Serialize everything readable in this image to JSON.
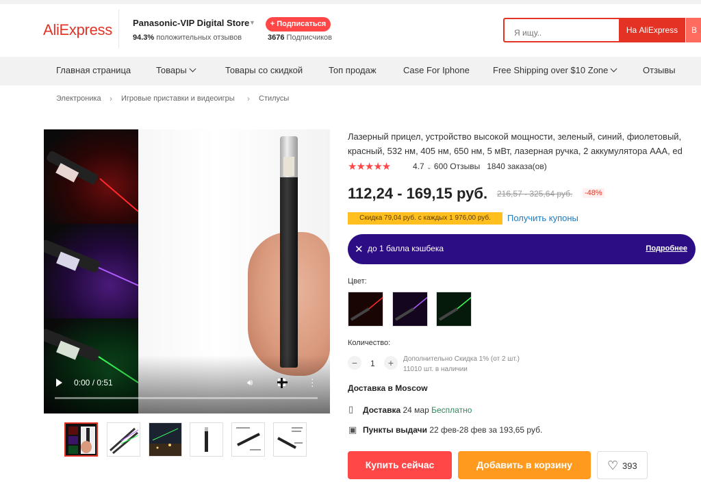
{
  "header": {
    "logo": "AliExpress",
    "store_name": "Panasonic-VIP Digital Store",
    "feedback_percent": "94.3%",
    "feedback_label": "положительных отзывов",
    "subscribe_label": "+ Подписаться",
    "subscribers_count": "3676",
    "subscribers_label": "Подписчиков",
    "search_placeholder": "Я ищу..",
    "search_on_aliexpress": "На AliExpress",
    "search_in_store": "В"
  },
  "nav": {
    "items": [
      "Главная страница",
      "Товары",
      "Товары со скидкой",
      "Топ продаж",
      "Case For Iphone",
      "Free Shipping over $10 Zone",
      "Отзывы"
    ]
  },
  "breadcrumb": [
    "Электроника",
    "Игровые приставки и видеоигры",
    "Стилусы"
  ],
  "video": {
    "time": "0:00 / 0:51"
  },
  "product": {
    "title": "Лазерный прицел, устройство высокой мощности, зеленый, синий, фиолетовый, красный, 532 нм, 405 нм, 650 нм, 5 мВт, лазерная ручка, 2 аккумулятора AAA, ed",
    "stars": "★★★★★",
    "rating": "4.7",
    "reviews": "600 Отзывы",
    "orders": "1840 заказа(ов)",
    "price": "112,24 - 169,15 руб.",
    "old_price": "216,57 - 325,64 руб.",
    "discount": "-48%",
    "coupon_text": "Скидка 79,04 руб. с каждых 1 976,00 руб.",
    "coupon_link": "Получить купоны",
    "cashback_text": "до 1 балла кэшбека",
    "cashback_more": "Подробнее",
    "color_label": "Цвет:",
    "color_options": [
      "red",
      "violet",
      "green"
    ],
    "quantity_label": "Количество:",
    "quantity": "1",
    "quantity_note": "Дополнительно Скидка 1% (от 2 шт.)",
    "stock": "11010 шт. в наличии",
    "shipping_title": "Доставка в Moscow",
    "delivery_label": "Доставка",
    "delivery_date": "24 мар",
    "delivery_price": "Бесплатно",
    "pickup_label": "Пункты выдачи",
    "pickup_info": "22 фев-28 фев за 193,65 руб.",
    "buy_now": "Купить сейчас",
    "add_to_cart": "Добавить в корзину",
    "wishlist_count": "393"
  },
  "colors": {
    "brand": "#e43225",
    "buy": "#ff4747",
    "cart": "#ff9a1f",
    "cashback": "#2c0d84",
    "coupon": "#ffc01f"
  }
}
